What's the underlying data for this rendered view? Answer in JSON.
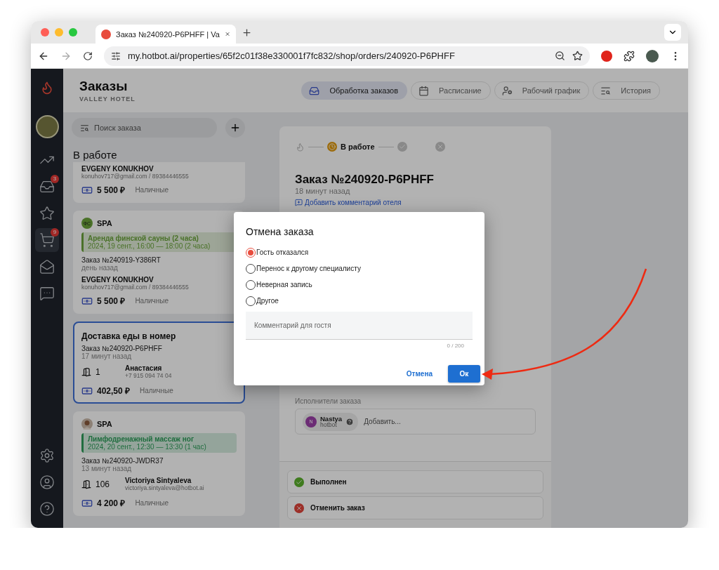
{
  "browser": {
    "tab_title": "Заказ №240920-P6PHFF | Va",
    "url": "my.hotbot.ai/properties/65f2c01f38e330001f7fc832/shop/orders/240920-P6PHFF"
  },
  "sidebar": {
    "items": [
      {
        "selected": false
      },
      {
        "selected": false,
        "badge": "3"
      },
      {
        "selected": false
      },
      {
        "selected": true,
        "badge": "9"
      },
      {
        "selected": false
      },
      {
        "selected": false
      }
    ]
  },
  "header": {
    "title": "Заказы",
    "subtitle": "VALLEY HOTEL",
    "tabs": [
      {
        "label": "Обработка заказов",
        "selected": true
      },
      {
        "label": "Расписание",
        "selected": false
      },
      {
        "label": "Рабочий график",
        "selected": false
      },
      {
        "label": "История",
        "selected": false
      }
    ]
  },
  "search": {
    "placeholder": "Поиск заказа"
  },
  "section_title": "В работе",
  "orders": [
    {
      "selected": false,
      "guest": "EVGENY KONUKHOV",
      "contact": "konuhov717@gmail.com / 89384446555",
      "amount": "5 500 ₽",
      "payment": "Наличные"
    },
    {
      "selected": false,
      "service": "SPA",
      "avatar": {
        "kind": "initials",
        "text": "ФС"
      },
      "booking": {
        "title": "Аренда финской сауны (2 часа)",
        "time": "2024, 19 сент., 16:00 — 18:00  (2 часа)",
        "color": "#4a7229"
      },
      "order_no": "Заказ №240919-Y386RT",
      "ago": "день назад",
      "guest": "EVGENY KONUKHOV",
      "contact": "konuhov717@gmail.com / 89384446555",
      "amount": "5 500 ₽",
      "payment": "Наличные"
    },
    {
      "selected": true,
      "title": "Доставка еды в номер",
      "order_no": "Заказ №240920-P6PHFF",
      "ago": "17 минут назад",
      "room": "1",
      "guest_name": "Анастасия",
      "contact": "+7 915 094 74 04",
      "amount": "402,50 ₽",
      "payment": "Наличные"
    },
    {
      "selected": false,
      "service": "SPA",
      "booking": {
        "title": "Лимфодренажный массаж ног",
        "time": "2024, 20 сент., 12:30 — 13:30  (1 час)",
        "color": "#206e40"
      },
      "order_no": "Заказ №240920-JWDR37",
      "ago": "13 минут назад",
      "room": "106",
      "guest_name": "Victoriya Sintyaleva",
      "contact": "victoriya.sintyaleva@hotbot.ai",
      "amount": "4 200 ₽",
      "payment": "Наличные"
    }
  ],
  "detail": {
    "steps": [
      {
        "kind": "new",
        "active": false
      },
      {
        "kind": "in_progress",
        "label": "В работе",
        "active": true
      },
      {
        "kind": "done",
        "active": false
      },
      {
        "kind": "cancelled",
        "active": false
      }
    ],
    "title": "Заказ №240920-P6PHFF",
    "ago": "18 минут назад",
    "comment_link": "Добавить комментарий отеля",
    "assignees_label": "Исполнители заказа",
    "assignee": {
      "initial": "N",
      "name": "Nastya",
      "org": "hotbot"
    },
    "add_placeholder": "Добавить...",
    "actions": [
      {
        "kind": "done",
        "label": "Выполнен"
      },
      {
        "kind": "cancel",
        "label": "Отменить заказ"
      }
    ]
  },
  "dialog": {
    "title": "Отмена заказа",
    "options": [
      {
        "label": "Гость отказался",
        "selected": true
      },
      {
        "label": "Перенос к другому специалисту",
        "selected": false
      },
      {
        "label": "Неверная запись",
        "selected": false
      },
      {
        "label": "Другое",
        "selected": false
      }
    ],
    "comment_placeholder": "Комментарий для гостя",
    "counter": "0 / 200",
    "cancel": "Отмена",
    "ok": "Ок"
  }
}
